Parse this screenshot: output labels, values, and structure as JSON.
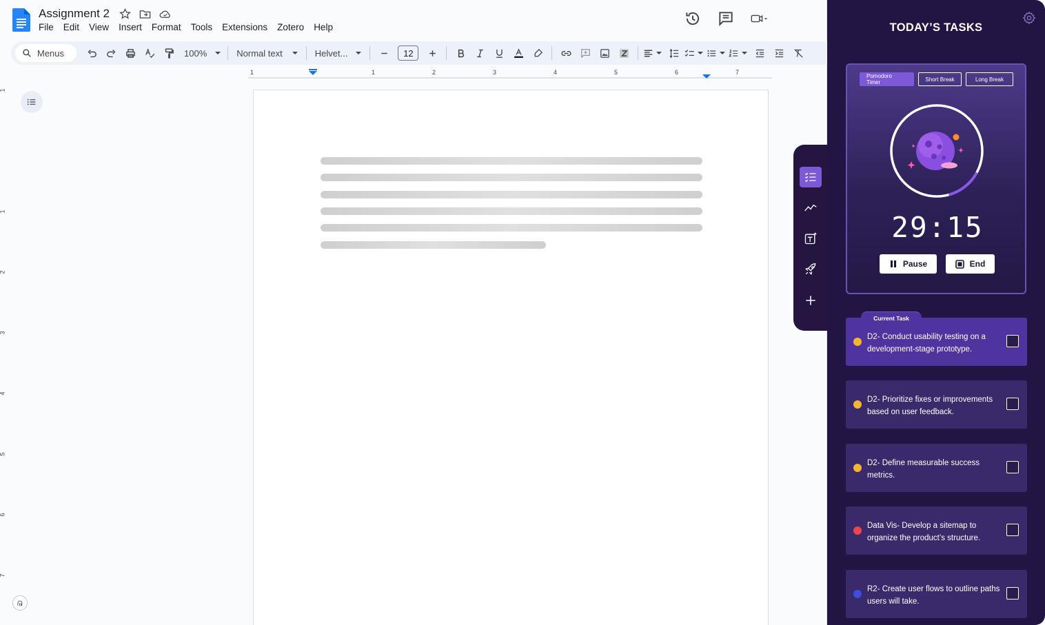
{
  "docs": {
    "title": "Assignment 2",
    "menu": [
      "File",
      "Edit",
      "View",
      "Insert",
      "Format",
      "Tools",
      "Extensions",
      "Zotero",
      "Help"
    ],
    "toolbar": {
      "search_label": "Menus",
      "zoom": "100%",
      "style": "Normal text",
      "font": "Helvet...",
      "font_size": "12"
    },
    "ruler_numbers": [
      "1",
      "1",
      "2",
      "3",
      "4",
      "5",
      "6",
      "7"
    ],
    "left_ruler_numbers": [
      "1",
      "1",
      "2",
      "3",
      "4",
      "5",
      "6",
      "7"
    ]
  },
  "strip": {
    "icons": [
      "tasks-list-icon",
      "trend-chart-icon",
      "text-ai-icon",
      "rocket-icon",
      "plus-icon"
    ]
  },
  "panel": {
    "title": "TODAY’S TASKS",
    "modes": [
      "Pomodoro Timer",
      "Short Break",
      "Long Break"
    ],
    "active_mode": "Pomodoro Timer",
    "time": "29:15",
    "timer_progress": 0.12,
    "pause_label": "Pause",
    "end_label": "End",
    "current_task_label": "Current Task",
    "tasks": [
      {
        "text": "D2- Conduct usability testing on a development-stage prototype.",
        "color": "#f5b52e",
        "current": true
      },
      {
        "text": "D2- Prioritize fixes or improvements based on user feedback.",
        "color": "#f5b52e",
        "current": false
      },
      {
        "text": "D2- Define measurable success metrics.",
        "color": "#f5b52e",
        "current": false
      },
      {
        "text": "Data Vis- Develop a sitemap to organize the product’s structure.",
        "color": "#e9474b",
        "current": false
      },
      {
        "text": "R2- Create user flows to outline paths users will take.",
        "color": "#3a4ee0",
        "current": false
      }
    ],
    "colors": {
      "accent": "#7d58d9",
      "panel_bg": "#231543"
    }
  }
}
